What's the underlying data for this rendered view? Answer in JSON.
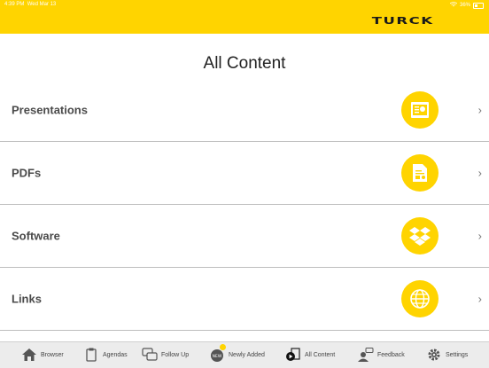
{
  "status_bar": {
    "time": "4:39 PM",
    "date": "Wed Mar 13",
    "battery": "36%"
  },
  "brand": {
    "logo_text": "TURCK",
    "accent_color": "#ffd400"
  },
  "page": {
    "title": "All Content"
  },
  "content_items": [
    {
      "label": "Presentations",
      "icon": "presentation-icon"
    },
    {
      "label": "PDFs",
      "icon": "pdf-document-icon"
    },
    {
      "label": "Software",
      "icon": "dropbox-icon"
    },
    {
      "label": "Links",
      "icon": "globe-icon"
    }
  ],
  "tabs": [
    {
      "label": "Browser",
      "icon": "home-icon"
    },
    {
      "label": "Agendas",
      "icon": "clipboard-icon"
    },
    {
      "label": "Follow Up",
      "icon": "chat-bubbles-icon"
    },
    {
      "label": "Newly Added",
      "icon": "new-badge-icon",
      "badge": ""
    },
    {
      "label": "All Content",
      "icon": "play-list-icon",
      "active": true
    },
    {
      "label": "Feedback",
      "icon": "feedback-person-icon"
    },
    {
      "label": "Settings",
      "icon": "gear-icon"
    }
  ]
}
